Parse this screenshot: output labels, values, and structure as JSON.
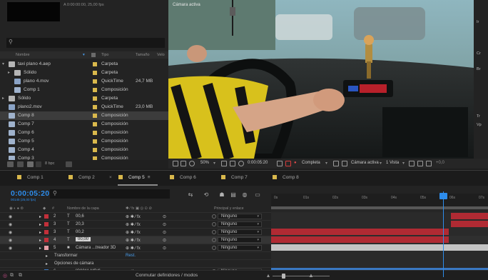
{
  "project": {
    "info_line": "A 0:00:00:00, 25,00 fps",
    "search_placeholder": "",
    "columns": {
      "name": "Nombre",
      "type": "Tipo",
      "size": "Tamaño",
      "rate": "Velo"
    },
    "rows": [
      {
        "name": "taxi plano 4.aep",
        "type": "Carpeta",
        "size": "",
        "indent": 0,
        "kind": "folder",
        "expanded": true
      },
      {
        "name": "Sólido",
        "type": "Carpeta",
        "size": "",
        "indent": 1,
        "kind": "folder",
        "expanded": false
      },
      {
        "name": "plano 4.mov",
        "type": "QuickTime",
        "size": "24,7 MB",
        "indent": 1,
        "kind": "footage"
      },
      {
        "name": "Comp 1",
        "type": "Composición",
        "size": "",
        "indent": 1,
        "kind": "comp"
      },
      {
        "name": "Sólido",
        "type": "Carpeta",
        "size": "",
        "indent": 0,
        "kind": "folder",
        "expanded": false
      },
      {
        "name": "plano2.mov",
        "type": "QuickTime",
        "size": "23,0 MB",
        "indent": 0,
        "kind": "footage"
      },
      {
        "name": "Comp 8",
        "type": "Composición",
        "size": "",
        "indent": 0,
        "kind": "comp",
        "selected": true
      },
      {
        "name": "Comp 7",
        "type": "Composición",
        "size": "",
        "indent": 0,
        "kind": "comp"
      },
      {
        "name": "Comp 6",
        "type": "Composición",
        "size": "",
        "indent": 0,
        "kind": "comp"
      },
      {
        "name": "Comp 5",
        "type": "Composición",
        "size": "",
        "indent": 0,
        "kind": "comp"
      },
      {
        "name": "Comp 4",
        "type": "Composición",
        "size": "",
        "indent": 0,
        "kind": "comp"
      },
      {
        "name": "Comp 3",
        "type": "Composición",
        "size": "",
        "indent": 0,
        "kind": "comp"
      }
    ],
    "bpc": "8 bpc"
  },
  "viewer": {
    "label": "Cámara activa",
    "zoom": "50%",
    "timecode": "0:00:05:20",
    "resolution": "Completa",
    "camera": "Cámara activa",
    "views": "1 Vista",
    "offset": "+0,0"
  },
  "right_panel": {
    "labels": [
      "Ir",
      "Cr",
      "Br",
      "Tr",
      "Vp"
    ]
  },
  "timeline": {
    "tabs": [
      "Comp 1",
      "Comp 2",
      "Comp 5",
      "Comp 6",
      "Comp 7",
      "Comp 8"
    ],
    "active_tab": "Comp 5",
    "timecode": "0:00:05:20",
    "fps_info": "00145 (25,00 fps)",
    "search_placeholder": "",
    "headers": {
      "num": "#",
      "layer_name": "Nombre de la capa",
      "switches": "✱ ⁄ fx ▣ ◎ ⊙ ⊘",
      "parent": "Principal y enlace"
    },
    "layers": [
      {
        "num": "2",
        "type": "T",
        "name": "00,6",
        "parent": "Ninguno",
        "color": "#c2303a"
      },
      {
        "num": "3",
        "type": "T",
        "name": "20,3",
        "parent": "Ninguno",
        "color": "#c2303a"
      },
      {
        "num": "3",
        "type": "T",
        "name": "00,2",
        "parent": "Ninguno",
        "color": "#c2303a"
      },
      {
        "num": "4",
        "type": "T",
        "name": "00,00",
        "parent": "Ninguno",
        "color": "#c2303a",
        "selected": true
      },
      {
        "num": "5",
        "type": "cam",
        "name": "Cámara ...treador 3D",
        "parent": "Ninguno",
        "color": "#e5a0a8"
      }
    ],
    "sub_rows": [
      {
        "label": "Transformar",
        "value": "Rest."
      },
      {
        "label": "Opciones de cámara",
        "value": ""
      }
    ],
    "footage_layer": {
      "num": "6",
      "name": "[C0011.MP4]",
      "parent": "Ninguno",
      "color": "#3a78c2"
    },
    "ruler_ticks": [
      "0s",
      "01s",
      "02s",
      "03s",
      "04s",
      "05s",
      "06s",
      "07s"
    ],
    "footer_toggle": "Conmutar definidores / modos"
  },
  "colors": {
    "accent": "#2d8ceb",
    "comp_swatch": "#d9b84c",
    "layer_red": "#c2303a",
    "layer_pink": "#e5a0a8"
  }
}
